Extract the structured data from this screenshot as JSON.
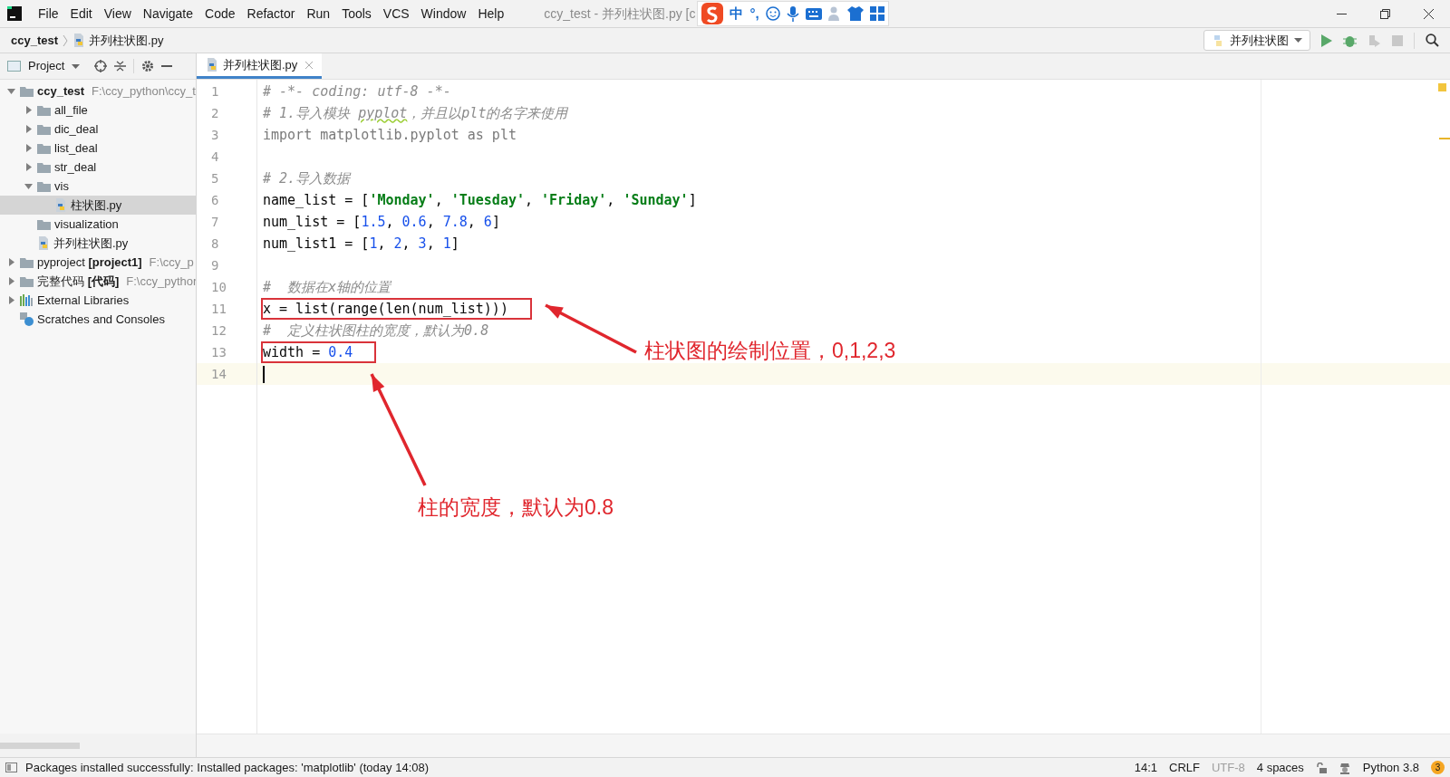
{
  "menu": [
    "File",
    "Edit",
    "View",
    "Navigate",
    "Code",
    "Refactor",
    "Run",
    "Tools",
    "VCS",
    "Window",
    "Help"
  ],
  "window": {
    "title": "ccy_test - 并列柱状图.py [c"
  },
  "ime_toolbar": {
    "mode": "中",
    "punctuation": "°,"
  },
  "breadcrumb": {
    "project": "ccy_test",
    "file": "并列柱状图.py"
  },
  "run_config": {
    "label": "并列柱状图"
  },
  "project_panel": {
    "title": "Project"
  },
  "tabs": [
    {
      "label": "并列柱状图.py",
      "selected": true
    }
  ],
  "tree": [
    {
      "kind": "folder",
      "label": "ccy_test",
      "bold": true,
      "path": "F:\\ccy_python\\ccy_t",
      "expanded": true,
      "selected": false,
      "children": [
        {
          "kind": "folder",
          "label": "all_file",
          "expanded": false,
          "selected": false
        },
        {
          "kind": "folder",
          "label": "dic_deal",
          "expanded": false,
          "selected": false
        },
        {
          "kind": "folder",
          "label": "list_deal",
          "expanded": false,
          "selected": false
        },
        {
          "kind": "folder",
          "label": "str_deal",
          "expanded": false,
          "selected": false
        },
        {
          "kind": "folder",
          "label": "vis",
          "expanded": true,
          "selected": false,
          "children": [
            {
              "kind": "file",
              "label": "柱状图.py",
              "selected": true
            }
          ]
        },
        {
          "kind": "folder",
          "label": "visualization",
          "selected": false
        },
        {
          "kind": "file",
          "label": "并列柱状图.py",
          "selected": false
        }
      ]
    },
    {
      "kind": "folder",
      "label": "pyproject **[project1]**",
      "path": "F:\\ccy_p",
      "expanded": false,
      "selected": false
    },
    {
      "kind": "folder",
      "label": "完整代码 **[代码]**",
      "path": "F:\\ccy_pythor",
      "expanded": false,
      "selected": false
    },
    {
      "kind": "library",
      "label": "External Libraries",
      "expanded": false,
      "selected": false
    },
    {
      "kind": "scratches",
      "label": "Scratches and Consoles",
      "selected": false
    }
  ],
  "code_lines": [
    {
      "number": "1",
      "tokens": [
        {
          "kind": "comment",
          "text": "# -*- coding: utf-8 -*-"
        }
      ]
    },
    {
      "number": "2",
      "tokens": [
        {
          "kind": "comment",
          "text": "# 1.导入模块 "
        },
        {
          "kind": "typo",
          "text": "pyplot"
        },
        {
          "kind": "comment",
          "text": "，并且以plt的名字来使用"
        }
      ]
    },
    {
      "number": "3",
      "tokens": [
        {
          "kind": "unused",
          "text": "import matplotlib.pyplot as plt"
        }
      ]
    },
    {
      "number": "4"
    },
    {
      "number": "5",
      "tokens": [
        {
          "kind": "comment",
          "text": "# 2.导入数据"
        }
      ]
    },
    {
      "number": "6",
      "tokens": [
        {
          "kind": "plain",
          "text": "name_list = ["
        },
        {
          "kind": "string",
          "text": "'Monday'"
        },
        {
          "kind": "plain",
          "text": ", "
        },
        {
          "kind": "string",
          "text": "'Tuesday'"
        },
        {
          "kind": "plain",
          "text": ", "
        },
        {
          "kind": "string",
          "text": "'Friday'"
        },
        {
          "kind": "plain",
          "text": ", "
        },
        {
          "kind": "string",
          "text": "'Sunday'"
        },
        {
          "kind": "plain",
          "text": "]"
        }
      ]
    },
    {
      "number": "7",
      "tokens": [
        {
          "kind": "plain",
          "text": "num_list = ["
        },
        {
          "kind": "number",
          "text": "1.5"
        },
        {
          "kind": "plain",
          "text": ", "
        },
        {
          "kind": "number",
          "text": "0.6"
        },
        {
          "kind": "plain",
          "text": ", "
        },
        {
          "kind": "number",
          "text": "7.8"
        },
        {
          "kind": "plain",
          "text": ", "
        },
        {
          "kind": "number",
          "text": "6"
        },
        {
          "kind": "plain",
          "text": "]"
        }
      ]
    },
    {
      "number": "8",
      "tokens": [
        {
          "kind": "plain",
          "text": "num_list1 = ["
        },
        {
          "kind": "number",
          "text": "1"
        },
        {
          "kind": "plain",
          "text": ", "
        },
        {
          "kind": "number",
          "text": "2"
        },
        {
          "kind": "plain",
          "text": ", "
        },
        {
          "kind": "number",
          "text": "3"
        },
        {
          "kind": "plain",
          "text": ", "
        },
        {
          "kind": "number",
          "text": "1"
        },
        {
          "kind": "plain",
          "text": "]"
        }
      ]
    },
    {
      "number": "9"
    },
    {
      "number": "10",
      "tokens": [
        {
          "kind": "comment",
          "text": "#  数据在x轴的位置"
        }
      ]
    },
    {
      "number": "11",
      "boxed": true,
      "tokens": [
        {
          "kind": "plain",
          "text": "x = list(range(len(num_list)))"
        }
      ]
    },
    {
      "number": "12",
      "tokens": [
        {
          "kind": "comment",
          "text": "#  定义柱状图柱的宽度，默认为0.8"
        }
      ]
    },
    {
      "number": "13",
      "boxed": true,
      "tokens": [
        {
          "kind": "plain",
          "text": "width = "
        },
        {
          "kind": "number",
          "text": "0.4"
        }
      ]
    },
    {
      "number": "14",
      "current": true
    }
  ],
  "annotations": [
    {
      "label": "柱状图的绘制位置，0,1,2,3"
    },
    {
      "label": "柱的宽度，默认为0.8"
    }
  ],
  "status_bar": {
    "message": "Packages installed successfully: Installed packages: 'matplotlib' (today 14:08)",
    "position": "14:1",
    "line_separator": "CRLF",
    "encoding": "UTF-8",
    "encoding_disabled": true,
    "indent": "4 spaces",
    "interpreter": "Python 3.8",
    "notifications": "3"
  }
}
